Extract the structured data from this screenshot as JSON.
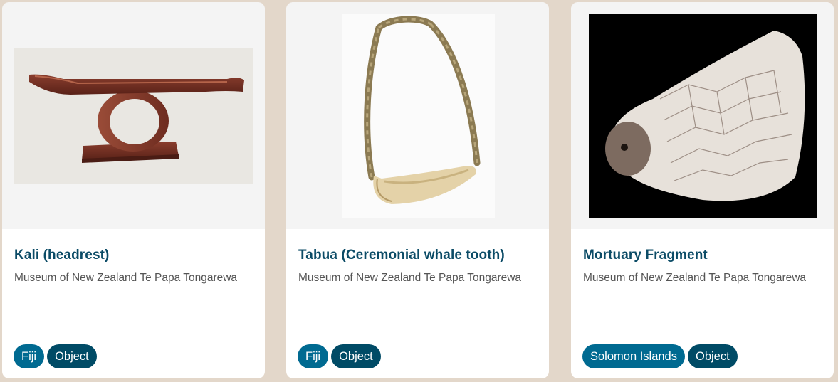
{
  "cards": [
    {
      "title": "Kali (headrest)",
      "source": "Museum of New Zealand Te Papa Tongarewa",
      "tags": [
        "Fiji",
        "Object"
      ]
    },
    {
      "title": "Tabua (Ceremonial whale tooth)",
      "source": "Museum of New Zealand Te Papa Tongarewa",
      "tags": [
        "Fiji",
        "Object"
      ]
    },
    {
      "title": "Mortuary Fragment",
      "source": "Museum of New Zealand Te Papa Tongarewa",
      "tags": [
        "Solomon Islands",
        "Object"
      ]
    }
  ],
  "colors": {
    "page_background": "#e3d7ca",
    "title": "#0b4b66",
    "place_tag": "#006a91",
    "type_tag": "#004b66"
  }
}
